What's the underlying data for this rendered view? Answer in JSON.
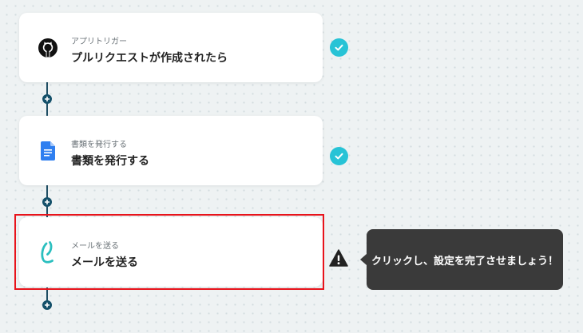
{
  "colors": {
    "accent": "#27c3d6",
    "connector": "#14506a",
    "highlight": "#e8131b",
    "tooltip_bg": "#3a3a3a",
    "background": "#eef2f3"
  },
  "flow": {
    "steps": [
      {
        "subtitle": "アプリトリガー",
        "title": "プルリクエストが作成されたら",
        "icon": "github-icon",
        "status": "completed",
        "status_icon": "check-icon"
      },
      {
        "subtitle": "書類を発行する",
        "title": "書類を発行する",
        "icon": "google-docs-icon",
        "status": "completed",
        "status_icon": "check-icon"
      },
      {
        "subtitle": "メールを送る",
        "title": "メールを送る",
        "icon": "mail-step-icon",
        "status": "incomplete",
        "status_icon": "warning-icon"
      }
    ],
    "add_step_icon": "plus-icon"
  },
  "tooltip": {
    "text": "クリックし、設定を完了させましょう！"
  }
}
